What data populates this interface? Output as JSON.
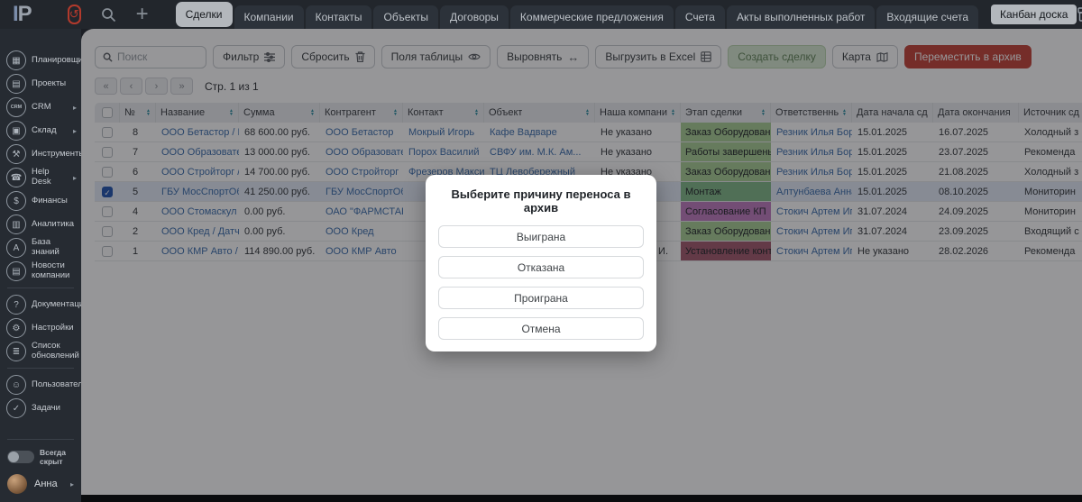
{
  "colors": {
    "accent_link": "#3d6fae",
    "archive_button_red": "#c4453a",
    "create_button_bg": "#d8e9d2",
    "create_button_text": "#64865c",
    "checkbox_checked_blue": "#2457b0",
    "sort_arrow_teal": "#2e8fa3",
    "stage_green": "#a9cf97",
    "stage_dark_green": "#83b98a",
    "stage_purple": "#c07ec0",
    "stage_maroon": "#a55c6f"
  },
  "topbar": {
    "logo": "IP",
    "tabs": [
      {
        "id": "deals",
        "label": "Сделки",
        "active": true
      },
      {
        "id": "companies",
        "label": "Компании",
        "active": false
      },
      {
        "id": "contacts",
        "label": "Контакты",
        "active": false
      },
      {
        "id": "objects",
        "label": "Объекты",
        "active": false
      },
      {
        "id": "agreements",
        "label": "Договоры",
        "active": false
      },
      {
        "id": "commercial-offers",
        "label": "Коммерческие предложения",
        "active": false
      },
      {
        "id": "invoices",
        "label": "Счета",
        "active": false
      },
      {
        "id": "work-acts",
        "label": "Акты выполненных работ",
        "active": false
      },
      {
        "id": "incoming-invoices",
        "label": "Входящие счета",
        "active": false
      }
    ],
    "kanban_button": "Канбан доска"
  },
  "sidebar": {
    "items": [
      {
        "id": "planner",
        "label": "Планировщик",
        "icon": "calendar-icon"
      },
      {
        "id": "projects",
        "label": "Проекты",
        "icon": "document-icon"
      },
      {
        "id": "crm",
        "label": "CRM",
        "icon": "crm-cloud-icon",
        "arrow": true
      },
      {
        "id": "warehouse",
        "label": "Склад",
        "icon": "box-icon",
        "arrow": true
      },
      {
        "id": "tools",
        "label": "Инструменты",
        "icon": "hammer-icon"
      },
      {
        "id": "helpdesk",
        "label": "Help Desk",
        "icon": "helpdesk-icon",
        "arrow": true
      },
      {
        "id": "finance",
        "label": "Финансы",
        "icon": "finance-icon"
      },
      {
        "id": "analytics",
        "label": "Аналитика",
        "icon": "analytics-icon"
      },
      {
        "id": "knowledge-base",
        "label": "База знаний",
        "icon": "book-icon"
      },
      {
        "id": "company-news",
        "label": "Новости компании",
        "icon": "news-icon",
        "divider_after": true
      },
      {
        "id": "documentation",
        "label": "Документация",
        "icon": "question-icon"
      },
      {
        "id": "settings",
        "label": "Настройки",
        "icon": "gear-icon"
      },
      {
        "id": "updates-list",
        "label": "Список обновлений",
        "icon": "update-list-icon",
        "divider_after": true
      },
      {
        "id": "users",
        "label": "Пользователи",
        "icon": "users-icon",
        "plus": true
      },
      {
        "id": "tasks",
        "label": "Задачи",
        "icon": "tasks-icon"
      }
    ],
    "toggle_label": "Всегда скрыт",
    "user_name": "Анна"
  },
  "toolbar": {
    "search_placeholder": "Поиск",
    "filter": "Фильтр",
    "reset": "Сбросить",
    "table_fields": "Поля таблицы",
    "align": "Выровнять",
    "export_excel": "Выгрузить в Excel",
    "create_deal": "Создать сделку",
    "map": "Карта",
    "move_to_archive": "Переместить в архив"
  },
  "pagination": {
    "page_text": "Стр. 1 из 1"
  },
  "table": {
    "columns": [
      {
        "label": "№",
        "sortable": true
      },
      {
        "label": "Название",
        "sortable": true
      },
      {
        "label": "Сумма",
        "sortable": true
      },
      {
        "label": "Контрагент",
        "sortable": true
      },
      {
        "label": "Контакт",
        "sortable": true
      },
      {
        "label": "Объект",
        "sortable": true
      },
      {
        "label": "Наша компания",
        "sortable": true
      },
      {
        "label": "Этап сделки",
        "sortable": true
      },
      {
        "label": "Ответственный",
        "sortable": true
      },
      {
        "label": "Дата начала сделки",
        "sortable": false
      },
      {
        "label": "Дата окончания сделк",
        "sortable": false
      },
      {
        "label": "Источник сд",
        "sortable": false
      }
    ],
    "rows": [
      {
        "num": "8",
        "name": "ООО Бетастор / М...",
        "sum": "68 600.00 руб.",
        "counterparty": "ООО Бетастор",
        "contact": "Мокрый Игорь",
        "object": "Кафе Вадваре",
        "company": "Не указано",
        "stage": "Заказ Оборудования",
        "stage_color": "#a9cf97",
        "responsible": "Резник Илья Борис...",
        "date_start": "15.01.2025",
        "date_end": "16.07.2025",
        "source": "Холодный з",
        "checked": false
      },
      {
        "num": "7",
        "name": "ООО Образовател...",
        "sum": "13 000.00 руб.",
        "counterparty": "ООО Образовател...",
        "contact": "Порох Василий",
        "object": "СВФУ им. М.К. Ам...",
        "company": "Не указано",
        "stage": "Работы завершены / С",
        "stage_color": "#a9cf97",
        "responsible": "Резник Илья Борис...",
        "date_start": "15.01.2025",
        "date_end": "23.07.2025",
        "source": "Рекоменда",
        "checked": false
      },
      {
        "num": "6",
        "name": "ООО Стройторг / С...",
        "sum": "14 700.00 руб.",
        "counterparty": "ООО Стройторг",
        "contact": "Фрезеров Максим",
        "object": "ТЦ Левобережный",
        "company": "Не указано",
        "stage": "Заказ Оборудования",
        "stage_color": "#a9cf97",
        "responsible": "Резник Илья Борис...",
        "date_start": "15.01.2025",
        "date_end": "21.08.2025",
        "source": "Холодный з",
        "checked": false
      },
      {
        "num": "5",
        "name": "ГБУ МосСпортОбъ...",
        "sum": "41 250.00 руб.",
        "counterparty": "ГБУ МосСпортОбъ...",
        "contact": "",
        "object": "",
        "company": "",
        "stage": "Монтаж",
        "stage_color": "#83b98a",
        "responsible": "Алтунбаева Анна ...",
        "date_start": "15.01.2025",
        "date_end": "08.10.2025",
        "source": "Мониторин",
        "checked": true
      },
      {
        "num": "4",
        "name": "ООО Стомаскул / ...",
        "sum": "0.00 руб.",
        "counterparty": "ОАО \"ФАРМСТАН...",
        "contact": "",
        "object": "",
        "company": "",
        "stage": "Согласование КП",
        "stage_color": "#c07ec0",
        "responsible": "Стокич Артем Игор...",
        "date_start": "31.07.2024",
        "date_end": "24.09.2025",
        "source": "Мониторин",
        "checked": false
      },
      {
        "num": "2",
        "name": "ООО Кред / Датчик...",
        "sum": "0.00 руб.",
        "counterparty": "ООО Кред",
        "contact": "",
        "object": "",
        "company": "",
        "stage": "Заказ Оборудования",
        "stage_color": "#a9cf97",
        "responsible": "Стокич Артем Игор...",
        "date_start": "31.07.2024",
        "date_end": "23.09.2025",
        "source": "Входящий с",
        "checked": false
      },
      {
        "num": "1",
        "name": "ООО КМР Авто / В...",
        "sum": "114 890.00 руб.",
        "counterparty": "ООО КМР Авто",
        "contact": "",
        "object": "",
        "company": "И.",
        "stage": "Установление контакта",
        "stage_color": "#a55c6f",
        "responsible": "Стокич Артем Игор...",
        "date_start": "Не указано",
        "date_end": "28.02.2026",
        "source": "Рекоменда",
        "checked": false
      }
    ]
  },
  "modal": {
    "title": "Выберите причину переноса в архив",
    "options": [
      "Выиграна",
      "Отказана",
      "Проиграна"
    ],
    "cancel_label": "Отмена"
  }
}
